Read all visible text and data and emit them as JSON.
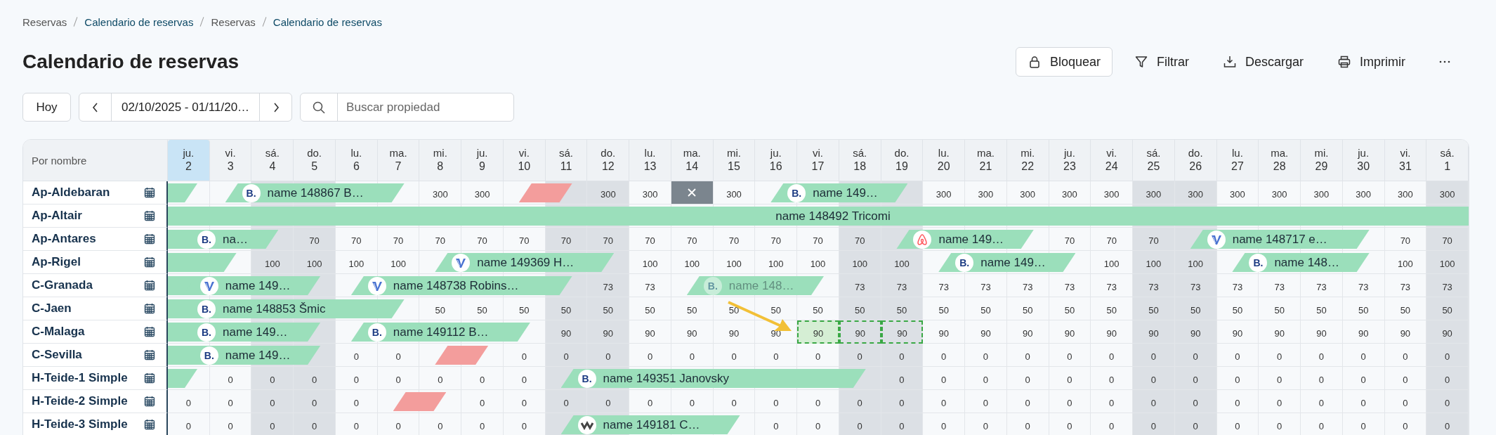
{
  "breadcrumbs": [
    {
      "label": "Reservas",
      "kind": "section"
    },
    {
      "label": "Calendario de reservas",
      "kind": "page"
    },
    {
      "label": "Reservas",
      "kind": "section"
    },
    {
      "label": "Calendario de reservas",
      "kind": "page"
    }
  ],
  "title": "Calendario de reservas",
  "actions": [
    {
      "kind": "lock",
      "label": "Bloquear",
      "outlined": true
    },
    {
      "kind": "filter",
      "label": "Filtrar",
      "outlined": false
    },
    {
      "kind": "download",
      "label": "Descargar",
      "outlined": false
    },
    {
      "kind": "print",
      "label": "Imprimir",
      "outlined": false
    },
    {
      "kind": "more",
      "outlined": false
    }
  ],
  "toolbar": {
    "today_button": "Hoy",
    "date_range": "02/10/2025 - 01/11/20…",
    "search": {
      "placeholder": "Buscar propiedad"
    }
  },
  "name_header": "Por nombre",
  "days": [
    {
      "weekday": "ju.",
      "day": "2",
      "today": true,
      "weekend": false
    },
    {
      "weekday": "vi.",
      "day": "3",
      "today": false,
      "weekend": false
    },
    {
      "weekday": "sá.",
      "day": "4",
      "today": false,
      "weekend": true
    },
    {
      "weekday": "do.",
      "day": "5",
      "today": false,
      "weekend": true
    },
    {
      "weekday": "lu.",
      "day": "6",
      "today": false,
      "weekend": false
    },
    {
      "weekday": "ma.",
      "day": "7",
      "today": false,
      "weekend": false
    },
    {
      "weekday": "mi.",
      "day": "8",
      "today": false,
      "weekend": false
    },
    {
      "weekday": "ju.",
      "day": "9",
      "today": false,
      "weekend": false
    },
    {
      "weekday": "vi.",
      "day": "10",
      "today": false,
      "weekend": false
    },
    {
      "weekday": "sá.",
      "day": "11",
      "today": false,
      "weekend": true
    },
    {
      "weekday": "do.",
      "day": "12",
      "today": false,
      "weekend": true
    },
    {
      "weekday": "lu.",
      "day": "13",
      "today": false,
      "weekend": false
    },
    {
      "weekday": "ma.",
      "day": "14",
      "today": false,
      "weekend": false
    },
    {
      "weekday": "mi.",
      "day": "15",
      "today": false,
      "weekend": false
    },
    {
      "weekday": "ju.",
      "day": "16",
      "today": false,
      "weekend": false
    },
    {
      "weekday": "vi.",
      "day": "17",
      "today": false,
      "weekend": false
    },
    {
      "weekday": "sá.",
      "day": "18",
      "today": false,
      "weekend": true
    },
    {
      "weekday": "do.",
      "day": "19",
      "today": false,
      "weekend": true
    },
    {
      "weekday": "lu.",
      "day": "20",
      "today": false,
      "weekend": false
    },
    {
      "weekday": "ma.",
      "day": "21",
      "today": false,
      "weekend": false
    },
    {
      "weekday": "mi.",
      "day": "22",
      "today": false,
      "weekend": false
    },
    {
      "weekday": "ju.",
      "day": "23",
      "today": false,
      "weekend": false
    },
    {
      "weekday": "vi.",
      "day": "24",
      "today": false,
      "weekend": false
    },
    {
      "weekday": "sá.",
      "day": "25",
      "today": false,
      "weekend": true
    },
    {
      "weekday": "do.",
      "day": "26",
      "today": false,
      "weekend": true
    },
    {
      "weekday": "lu.",
      "day": "27",
      "today": false,
      "weekend": false
    },
    {
      "weekday": "ma.",
      "day": "28",
      "today": false,
      "weekend": false
    },
    {
      "weekday": "mi.",
      "day": "29",
      "today": false,
      "weekend": false
    },
    {
      "weekday": "ju.",
      "day": "30",
      "today": false,
      "weekend": false
    },
    {
      "weekday": "vi.",
      "day": "31",
      "today": false,
      "weekend": false
    },
    {
      "weekday": "sá.",
      "day": "1",
      "today": false,
      "weekend": true
    }
  ],
  "rows": [
    {
      "name": "Ap-Aldebaran",
      "cells": [
        {
          "kind": "checkout"
        },
        {
          "kind": "booking",
          "logo": {
            "kind": "booking",
            "text": "B."
          },
          "label": "name 148867 B…"
        },
        {
          "kind": "stay"
        },
        {
          "kind": "stay"
        },
        {
          "kind": "stay"
        },
        {
          "kind": "checkout"
        },
        "300",
        "300",
        {
          "kind": "blocked"
        },
        {
          "kind": "checkout"
        },
        "300",
        "300",
        {
          "kind": "closed"
        },
        "300",
        {
          "kind": "booking",
          "logo": {
            "kind": "booking",
            "text": "B."
          },
          "label": "name 149…"
        },
        {
          "kind": "stay"
        },
        {
          "kind": "stay"
        },
        {
          "kind": "checkout"
        },
        "300",
        "300",
        "300",
        "300",
        "300",
        "300",
        "300",
        "300",
        "300",
        "300",
        "300",
        "300",
        "300"
      ]
    },
    {
      "name": "Ap-Altair",
      "cells": [
        {
          "kind": "booking",
          "starts_before": true,
          "label": "name 148492 Tricomi"
        },
        {
          "kind": "stay"
        },
        {
          "kind": "stay"
        },
        {
          "kind": "stay"
        },
        {
          "kind": "stay"
        },
        {
          "kind": "stay"
        },
        {
          "kind": "stay"
        },
        {
          "kind": "stay"
        },
        {
          "kind": "stay"
        },
        {
          "kind": "stay"
        },
        {
          "kind": "stay"
        },
        {
          "kind": "stay"
        },
        {
          "kind": "stay"
        },
        {
          "kind": "stay"
        },
        {
          "kind": "stay"
        },
        {
          "kind": "stay"
        },
        {
          "kind": "stay"
        },
        {
          "kind": "stay"
        },
        {
          "kind": "stay"
        },
        {
          "kind": "stay"
        },
        {
          "kind": "stay"
        },
        {
          "kind": "stay"
        },
        {
          "kind": "stay"
        },
        {
          "kind": "stay"
        },
        {
          "kind": "stay"
        },
        {
          "kind": "stay"
        },
        {
          "kind": "stay"
        },
        {
          "kind": "stay"
        },
        {
          "kind": "stay"
        },
        {
          "kind": "stay"
        },
        {
          "kind": "stay"
        }
      ]
    },
    {
      "name": "Ap-Antares",
      "cells": [
        {
          "kind": "booking",
          "starts_before": true,
          "logo": {
            "kind": "booking",
            "text": "B."
          },
          "label": "na…"
        },
        {
          "kind": "stay"
        },
        {
          "kind": "checkout"
        },
        "70",
        "70",
        "70",
        "70",
        "70",
        "70",
        "70",
        "70",
        "70",
        "70",
        "70",
        "70",
        "70",
        "70",
        {
          "kind": "booking",
          "logo": {
            "kind": "airbnb"
          },
          "label": "name 149…"
        },
        {
          "kind": "stay"
        },
        {
          "kind": "stay"
        },
        {
          "kind": "checkout"
        },
        "70",
        "70",
        "70",
        {
          "kind": "booking",
          "logo": {
            "kind": "vrbo"
          },
          "label": "name 148717 e…"
        },
        {
          "kind": "stay"
        },
        {
          "kind": "stay"
        },
        {
          "kind": "stay"
        },
        {
          "kind": "checkout"
        },
        "70",
        "70"
      ]
    },
    {
      "name": "Ap-Rigel",
      "cells": [
        {
          "kind": "stay"
        },
        {
          "kind": "checkout"
        },
        "100",
        "100",
        "100",
        "100",
        {
          "kind": "booking",
          "logo": {
            "kind": "vrbo"
          },
          "label": "name 149369 H…"
        },
        {
          "kind": "stay"
        },
        {
          "kind": "stay"
        },
        {
          "kind": "stay"
        },
        {
          "kind": "checkout"
        },
        "100",
        "100",
        "100",
        "100",
        "100",
        "100",
        "100",
        {
          "kind": "booking",
          "logo": {
            "kind": "booking",
            "text": "B."
          },
          "label": "name 149…"
        },
        {
          "kind": "stay"
        },
        {
          "kind": "stay"
        },
        {
          "kind": "checkout"
        },
        "100",
        "100",
        "100",
        {
          "kind": "booking",
          "logo": {
            "kind": "booking",
            "text": "B."
          },
          "label": "name 148…"
        },
        {
          "kind": "stay"
        },
        {
          "kind": "stay"
        },
        {
          "kind": "checkout"
        },
        "100",
        "100"
      ]
    },
    {
      "name": "C-Granada",
      "cells": [
        {
          "kind": "booking",
          "turnover": true,
          "logo": {
            "kind": "vrbo"
          },
          "label": "name 149…"
        },
        {
          "kind": "stay"
        },
        {
          "kind": "stay"
        },
        {
          "kind": "checkout"
        },
        {
          "kind": "booking",
          "logo": {
            "kind": "vrbo"
          },
          "label": "name 148738 Robins…"
        },
        {
          "kind": "stay"
        },
        {
          "kind": "stay"
        },
        {
          "kind": "stay"
        },
        {
          "kind": "stay"
        },
        {
          "kind": "checkout"
        },
        "73",
        "73",
        {
          "kind": "booking",
          "logo": {
            "kind": "booking",
            "text": "B."
          },
          "label": "name 148…",
          "faded": true
        },
        {
          "kind": "stay"
        },
        {
          "kind": "stay"
        },
        {
          "kind": "checkout"
        },
        "73",
        "73",
        "73",
        "73",
        "73",
        "73",
        "73",
        "73",
        "73",
        "73",
        "73",
        "73",
        "73",
        "73",
        "73"
      ]
    },
    {
      "name": "C-Jaen",
      "cells": [
        {
          "kind": "booking",
          "starts_before": true,
          "logo": {
            "kind": "booking",
            "text": "B."
          },
          "label": "name 148853 Šmic"
        },
        {
          "kind": "stay"
        },
        {
          "kind": "stay"
        },
        {
          "kind": "stay"
        },
        {
          "kind": "stay"
        },
        {
          "kind": "checkout"
        },
        "50",
        "50",
        "50",
        "50",
        "50",
        "50",
        "50",
        "50",
        "50",
        "50",
        "50",
        "50",
        "50",
        "50",
        "50",
        "50",
        "50",
        "50",
        "50",
        "50",
        "50",
        "50",
        "50",
        "50",
        "50"
      ]
    },
    {
      "name": "C-Malaga",
      "cells": [
        {
          "kind": "booking",
          "starts_before": true,
          "logo": {
            "kind": "booking",
            "text": "B."
          },
          "label": "name 149…"
        },
        {
          "kind": "stay"
        },
        {
          "kind": "stay"
        },
        {
          "kind": "checkout"
        },
        {
          "kind": "booking",
          "logo": {
            "kind": "booking",
            "text": "B."
          },
          "label": "name 149112 B…"
        },
        {
          "kind": "stay"
        },
        {
          "kind": "stay"
        },
        {
          "kind": "stay"
        },
        {
          "kind": "checkout"
        },
        "90",
        "90",
        "90",
        "90",
        "90",
        "90",
        {
          "kind": "price",
          "text": "90",
          "selected": true,
          "highlighted": true
        },
        {
          "kind": "price",
          "text": "90",
          "selected": true,
          "highlighted": false
        },
        {
          "kind": "price",
          "text": "90",
          "selected": true,
          "highlighted": false
        },
        "90",
        "90",
        "90",
        "90",
        "90",
        "90",
        "90",
        "90",
        "90",
        "90",
        "90",
        "90",
        "90"
      ]
    },
    {
      "name": "C-Sevilla",
      "cells": [
        {
          "kind": "booking",
          "turnover": true,
          "logo": {
            "kind": "booking",
            "text": "B."
          },
          "label": "name 149…"
        },
        {
          "kind": "stay"
        },
        {
          "kind": "stay"
        },
        {
          "kind": "checkout"
        },
        "0",
        "0",
        {
          "kind": "blocked"
        },
        {
          "kind": "checkout"
        },
        "0",
        "0",
        "0",
        "0",
        "0",
        "0",
        "0",
        "0",
        "0",
        "0",
        "0",
        "0",
        "0",
        "0",
        "0",
        "0",
        "0",
        "0",
        "0",
        "0",
        "0",
        "0",
        "0"
      ]
    },
    {
      "name": "H-Teide-1 Simple",
      "cells": [
        {
          "kind": "checkout"
        },
        "0",
        "0",
        "0",
        "0",
        "0",
        "0",
        "0",
        "0",
        {
          "kind": "booking",
          "logo": {
            "kind": "booking",
            "text": "B."
          },
          "label": "name 149351 Janovsky"
        },
        {
          "kind": "stay"
        },
        {
          "kind": "stay"
        },
        {
          "kind": "stay"
        },
        {
          "kind": "stay"
        },
        {
          "kind": "stay"
        },
        {
          "kind": "stay"
        },
        {
          "kind": "checkout"
        },
        "0",
        "0",
        "0",
        "0",
        "0",
        "0",
        "0",
        "0",
        "0",
        "0",
        "0",
        "0",
        "0",
        "0"
      ]
    },
    {
      "name": "H-Teide-2 Simple",
      "cells": [
        "0",
        "0",
        "0",
        "0",
        "0",
        {
          "kind": "blocked"
        },
        {
          "kind": "checkout"
        },
        "0",
        "0",
        "0",
        "0",
        "0",
        "0",
        "0",
        "0",
        "0",
        "0",
        "0",
        "0",
        "0",
        "0",
        "0",
        "0",
        "0",
        "0",
        "0",
        "0",
        "0",
        "0",
        "0",
        "0"
      ]
    },
    {
      "name": "H-Teide-3 Simple",
      "cells": [
        "0",
        "0",
        "0",
        "0",
        "0",
        "0",
        "0",
        "0",
        "0",
        {
          "kind": "booking",
          "logo": {
            "kind": "other"
          },
          "label": "name 149181 C…"
        },
        {
          "kind": "stay"
        },
        {
          "kind": "stay"
        },
        {
          "kind": "stay"
        },
        {
          "kind": "checkout"
        },
        "0",
        "0",
        "0",
        "0",
        "0",
        "0",
        "0",
        "0",
        "0",
        "0",
        "0",
        "0",
        "0",
        "0",
        "0",
        "0",
        "0"
      ]
    }
  ]
}
